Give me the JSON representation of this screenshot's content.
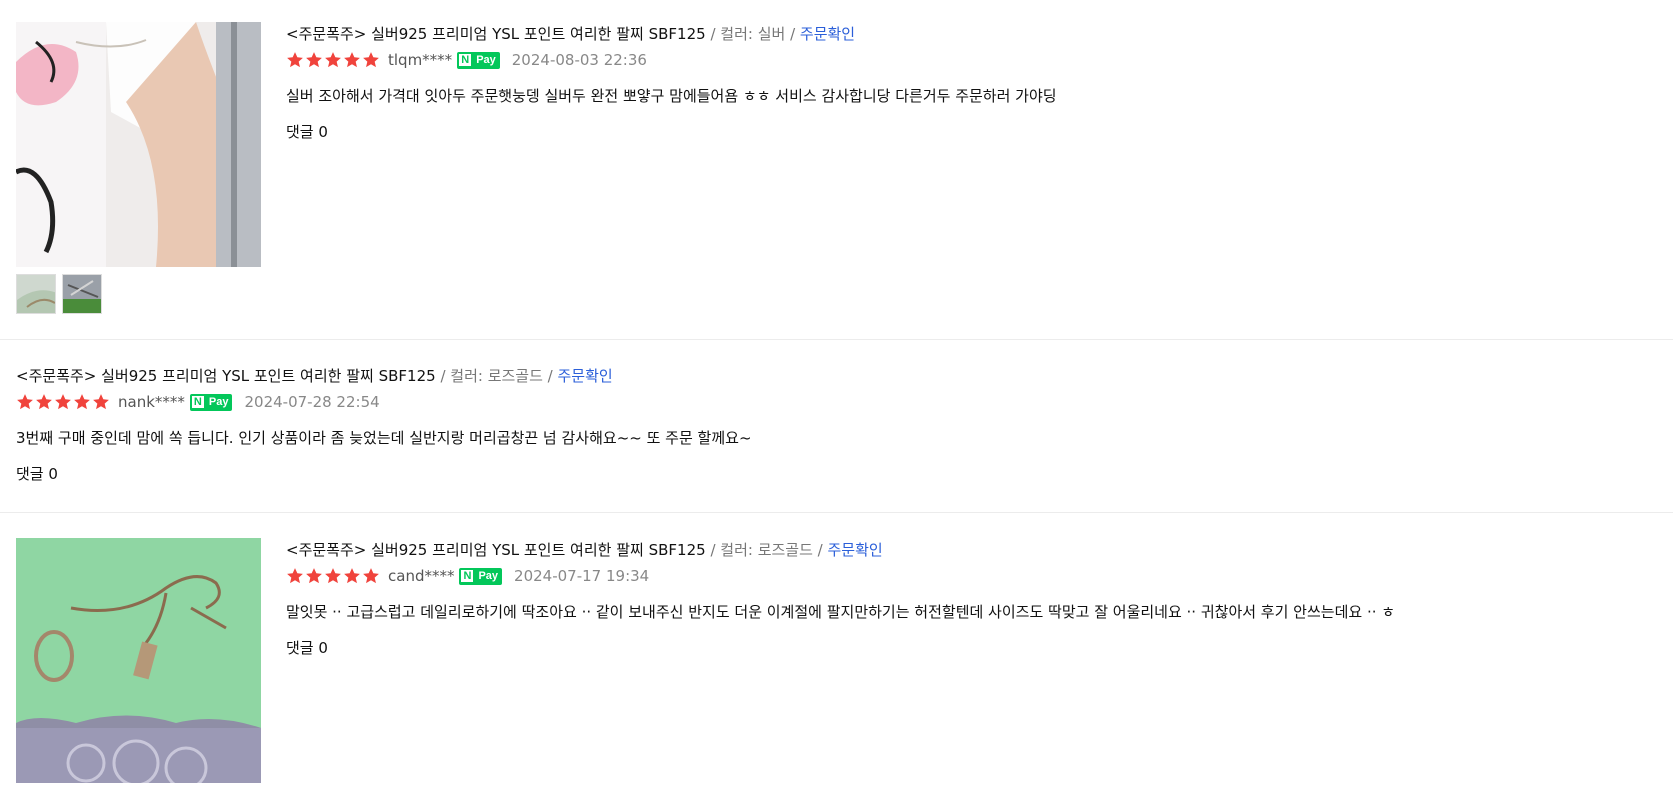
{
  "colors": {
    "star": "#f0433c",
    "npay": "#03c75a",
    "link": "#2b5fd9",
    "meta": "#888888"
  },
  "reviews": [
    {
      "product": "<주문폭주> 실버925 프리미엄 YSL 포인트 여리한 팔찌 SBF125",
      "sep1": " / ",
      "option": "컬러: 실버",
      "sep2": " / ",
      "confirm": "주문확인",
      "rating": 5,
      "user": "tlqm****",
      "npay_label": "Pay",
      "npay_n": "N",
      "date": "2024-08-03 22:36",
      "text": "실버 조아해서 가격대 잇아두 주문햇눙뎅 실버두 완전 뽀얗구 맘에들어욤 ㅎㅎ 서비스 감사합니당 다른거두 주문하러 가야딩",
      "comments": "댓글 0",
      "has_photo": true,
      "thumb_count": 2
    },
    {
      "product": "<주문폭주> 실버925 프리미엄 YSL 포인트 여리한 팔찌 SBF125",
      "sep1": " / ",
      "option": "컬러: 로즈골드",
      "sep2": " / ",
      "confirm": "주문확인",
      "rating": 5,
      "user": "nank****",
      "npay_label": "Pay",
      "npay_n": "N",
      "date": "2024-07-28 22:54",
      "text": "3번째 구매 중인데 맘에 쏙 듭니다. 인기 상품이라 좀 늦었는데 실반지랑 머리곱창끈 넘 감사해요~~ 또 주문 할께요~",
      "comments": "댓글 0",
      "has_photo": false,
      "thumb_count": 0
    },
    {
      "product": "<주문폭주> 실버925 프리미엄 YSL 포인트 여리한 팔찌 SBF125",
      "sep1": " / ",
      "option": "컬러: 로즈골드",
      "sep2": " / ",
      "confirm": "주문확인",
      "rating": 5,
      "user": "cand****",
      "npay_label": "Pay",
      "npay_n": "N",
      "date": "2024-07-17 19:34",
      "text": "말잇못 ·· 고급스럽고 데일리로하기에 딱조아요  ·· 같이 보내주신 반지도 더운 이계절에 팔지만하기는 허전할텐데 사이즈도 딱맞고 잘 어울리네요 ·· 귀찮아서 후기 안쓰는데요  ·· ㅎ",
      "comments": "댓글 0",
      "has_photo": true,
      "thumb_count": 0
    }
  ]
}
